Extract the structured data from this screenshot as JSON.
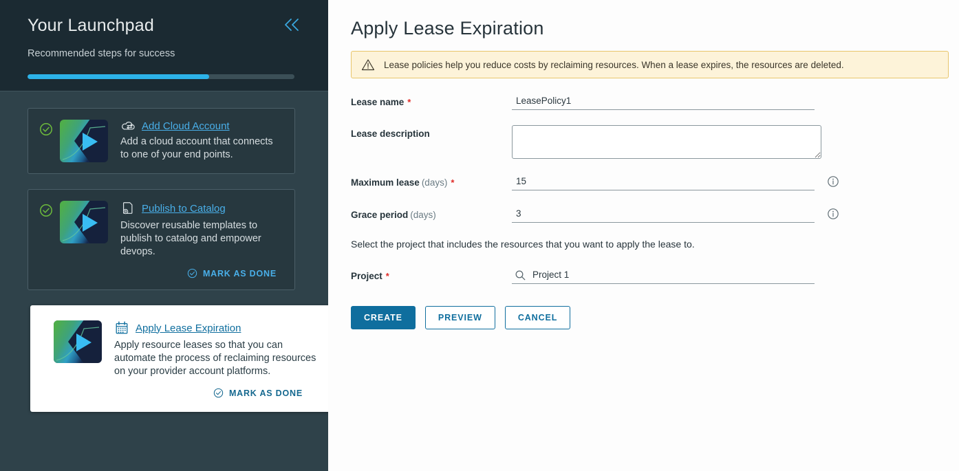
{
  "sidebar": {
    "title": "Your Launchpad",
    "subtitle": "Recommended steps for success",
    "progress_percent": 68,
    "collapse_icon": "double-chevron-left-icon",
    "cards": [
      {
        "status_icon": "check-circle-icon",
        "thumbnail_icon": "video-thumbnail",
        "link_icon": "cloud-transfer-icon",
        "link": "Add Cloud Account",
        "description": "Add a cloud account that connects to one of your end points.",
        "mark_done": null
      },
      {
        "status_icon": "check-circle-icon",
        "thumbnail_icon": "video-thumbnail",
        "link_icon": "document-gear-icon",
        "link": "Publish to Catalog",
        "description": "Discover reusable templates to publish to catalog and empower devops.",
        "mark_done": "MARK AS DONE",
        "mark_done_icon": "check-circle-outline-icon"
      },
      {
        "status_icon": null,
        "thumbnail_icon": "video-thumbnail",
        "link_icon": "calendar-icon",
        "link": "Apply Lease Expiration",
        "description": "Apply resource leases so that you can automate the process of reclaiming resources on your provider account platforms.",
        "mark_done": "MARK AS DONE",
        "mark_done_icon": "check-circle-outline-icon"
      }
    ]
  },
  "main": {
    "title": "Apply Lease Expiration",
    "alert": {
      "icon": "warning-triangle-icon",
      "text": "Lease policies help you reduce costs by reclaiming resources. When a lease expires, the resources are deleted."
    },
    "fields": {
      "lease_name": {
        "label": "Lease name",
        "required": "*",
        "value": "LeasePolicy1",
        "placeholder": ""
      },
      "lease_description": {
        "label": "Lease description",
        "required": "",
        "value": "",
        "placeholder": ""
      },
      "maximum_lease": {
        "label": "Maximum lease",
        "unit": "(days)",
        "required": "*",
        "value": "15",
        "placeholder": "",
        "info_icon": "info-circle-icon"
      },
      "grace_period": {
        "label": "Grace period",
        "unit": "(days)",
        "required": "",
        "value": "3",
        "placeholder": "",
        "info_icon": "info-circle-icon"
      },
      "project": {
        "label": "Project",
        "required": "*",
        "value": "Project 1",
        "placeholder": "",
        "search_icon": "search-icon"
      }
    },
    "helper_text": "Select the project that includes the resources that you want to apply the lease to.",
    "buttons": {
      "create": "CREATE",
      "preview": "PREVIEW",
      "cancel": "CANCEL"
    }
  },
  "colors": {
    "sidebar_header_bg": "#1b2a32",
    "sidebar_bg": "#2f424a",
    "card_bg": "#27383f",
    "accent_blue": "#49afe9",
    "primary_blue": "#0f6e9e",
    "progress_fill": "#2cb2e8",
    "success_green": "#6dbb3c",
    "alert_bg": "#fdf3d9",
    "alert_border": "#e8c56a",
    "required_red": "#e02b27"
  }
}
